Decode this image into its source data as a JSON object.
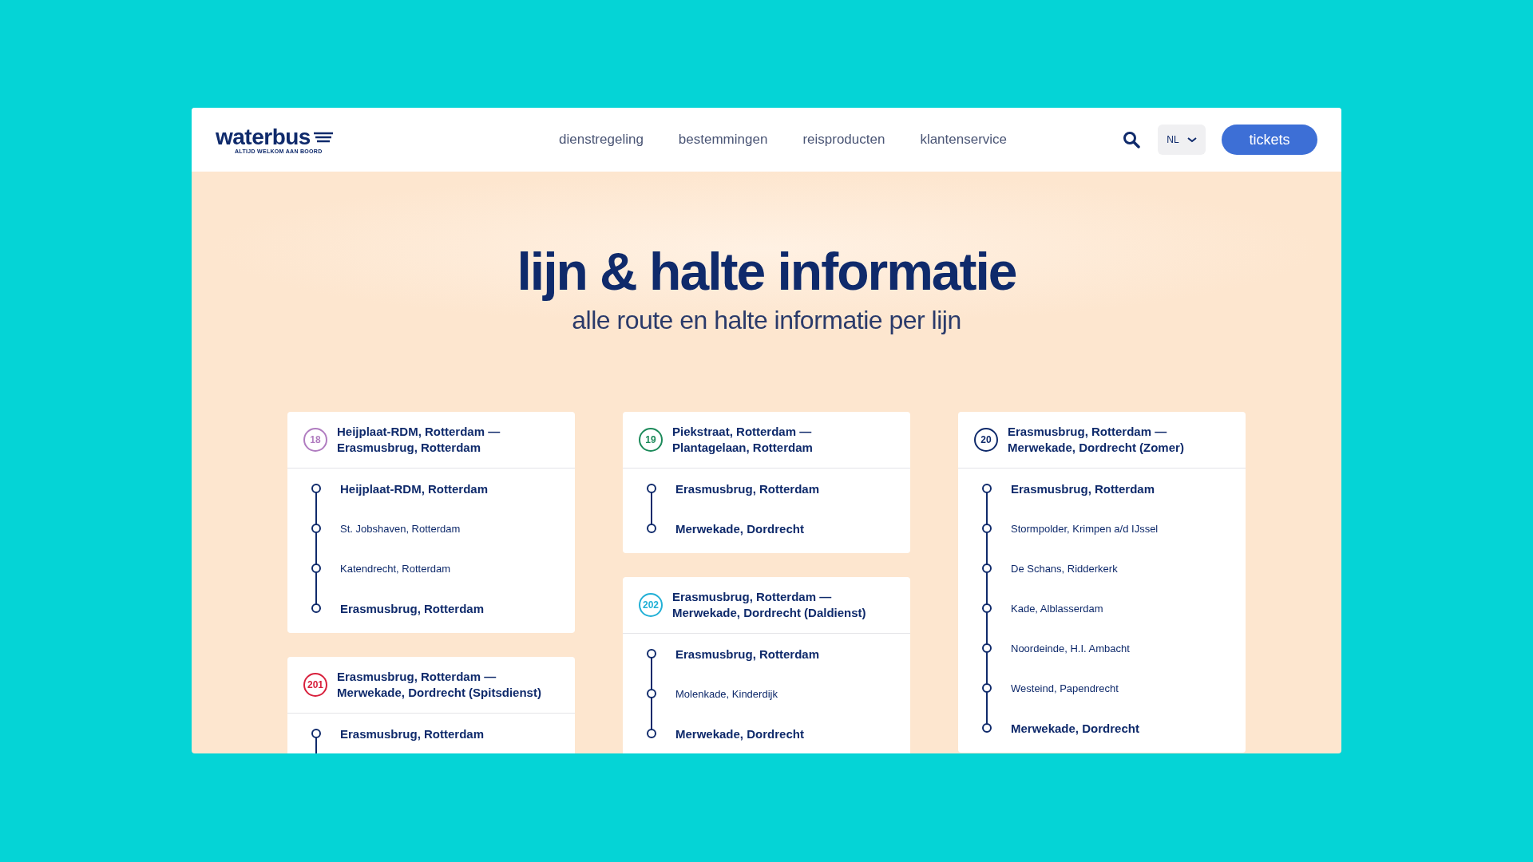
{
  "header": {
    "logo": {
      "name": "waterbus",
      "tagline": "ALTIJD WELKOM AAN BOORD"
    },
    "nav": [
      {
        "label": "dienstregeling"
      },
      {
        "label": "bestemmingen"
      },
      {
        "label": "reisproducten"
      },
      {
        "label": "klantenservice"
      }
    ],
    "language": "NL",
    "tickets_button": "tickets"
  },
  "hero": {
    "title": "lijn & halte informatie",
    "subtitle": "alle route en halte informatie per lijn"
  },
  "columns": [
    {
      "lines": [
        {
          "number": "18",
          "color": "#b07cc0",
          "title": "Heijplaat-RDM, Rotterdam — Erasmusbrug, Rotterdam",
          "truncated": false,
          "stops": [
            {
              "name": "Heijplaat-RDM, Rotterdam",
              "kind": "major"
            },
            {
              "name": "St. Jobshaven, Rotterdam",
              "kind": "minor"
            },
            {
              "name": "Katendrecht, Rotterdam",
              "kind": "minor"
            },
            {
              "name": "Erasmusbrug, Rotterdam",
              "kind": "major"
            }
          ]
        },
        {
          "number": "201",
          "color": "#d8203c",
          "title": "Erasmusbrug, Rotterdam — Merwekade, Dordrecht (Spitsdienst)",
          "truncated": true,
          "stops": [
            {
              "name": "Erasmusbrug, Rotterdam",
              "kind": "major"
            }
          ]
        }
      ]
    },
    {
      "lines": [
        {
          "number": "19",
          "color": "#1c8a5a",
          "title": "Piekstraat, Rotterdam — Plantagelaan, Rotterdam",
          "truncated": false,
          "stops": [
            {
              "name": "Erasmusbrug, Rotterdam",
              "kind": "major"
            },
            {
              "name": "Merwekade, Dordrecht",
              "kind": "major"
            }
          ]
        },
        {
          "number": "202",
          "color": "#22b0d6",
          "title": "Erasmusbrug, Rotterdam — Merwekade, Dordrecht (Daldienst)",
          "truncated": false,
          "stops": [
            {
              "name": "Erasmusbrug, Rotterdam",
              "kind": "major"
            },
            {
              "name": "Molenkade, Kinderdijk",
              "kind": "minor"
            },
            {
              "name": "Merwekade, Dordrecht",
              "kind": "major"
            }
          ]
        }
      ]
    },
    {
      "lines": [
        {
          "number": "20",
          "color": "#0f2a6b",
          "title": "Erasmusbrug, Rotterdam — Merwekade, Dordrecht (Zomer)",
          "truncated": false,
          "stops": [
            {
              "name": "Erasmusbrug, Rotterdam",
              "kind": "major"
            },
            {
              "name": "Stormpolder, Krimpen a/d IJssel",
              "kind": "minor"
            },
            {
              "name": "De Schans, Ridderkerk",
              "kind": "minor"
            },
            {
              "name": "Kade, Alblasserdam",
              "kind": "minor"
            },
            {
              "name": "Noordeinde, H.I. Ambacht",
              "kind": "minor"
            },
            {
              "name": "Westeind, Papendrecht",
              "kind": "minor"
            },
            {
              "name": "Merwekade, Dordrecht",
              "kind": "major"
            }
          ]
        }
      ]
    }
  ]
}
